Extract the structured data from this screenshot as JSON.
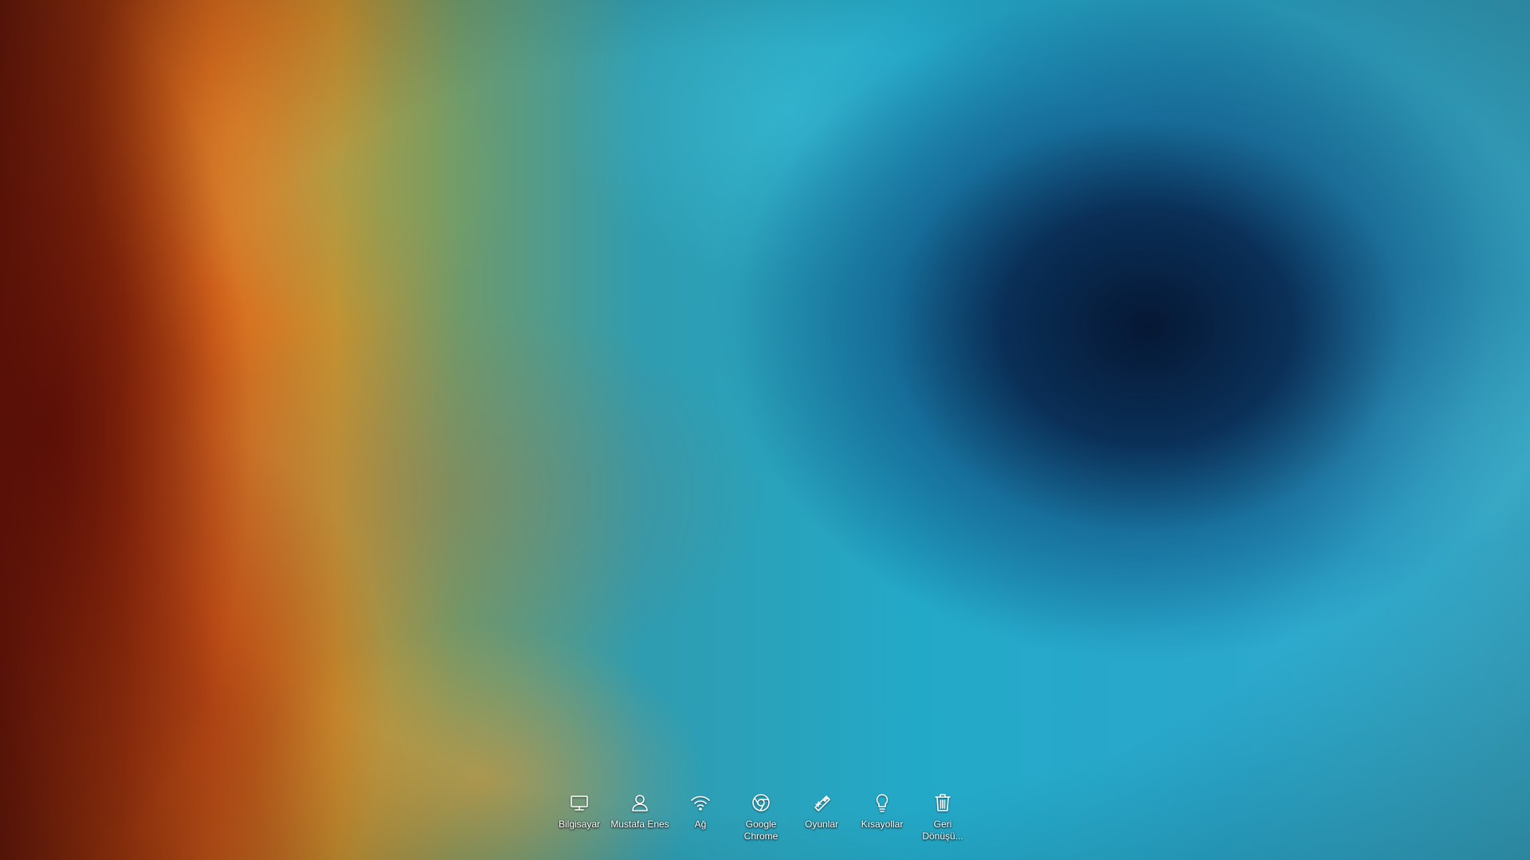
{
  "desktop": {
    "wallpaper": "helix-nebula-cosmic-eye",
    "colors": {
      "nebula_center": "#061a36",
      "nebula_cyan": "#2aa8cc",
      "nebula_orange": "#d5621b",
      "nebula_red": "#6e1a0a",
      "label_text": "#ffffff"
    },
    "icons": [
      {
        "label": "Bilgisayar",
        "icon": "monitor-icon"
      },
      {
        "label": "Mustafa Enes",
        "icon": "user-icon"
      },
      {
        "label": "Ağ",
        "icon": "wifi-icon"
      },
      {
        "label": "Google Chrome",
        "icon": "chrome-icon"
      },
      {
        "label": "Oyunlar",
        "icon": "game-controller-icon"
      },
      {
        "label": "Kısayollar",
        "icon": "lightbulb-icon"
      },
      {
        "label": "Geri Dönüşü...",
        "icon": "trash-icon"
      }
    ]
  }
}
